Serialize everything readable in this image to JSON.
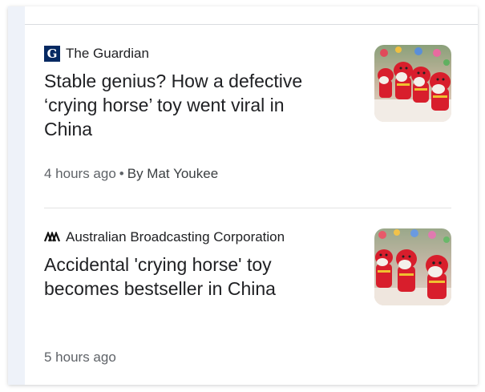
{
  "articles": [
    {
      "source": "The Guardian",
      "source_logo": "guardian-logo-icon",
      "headline": "Stable genius? How a defective ‘crying horse’ toy went viral in China",
      "time": "4 hours ago",
      "separator": "•",
      "byline": "By Mat Youkee",
      "thumbnail": "crying-horse-toys-photo"
    },
    {
      "source": "Australian Broadcasting Corporation",
      "source_logo": "abc-logo-icon",
      "headline": "Accidental 'crying horse' toy becomes bestseller in China",
      "time": "5 hours ago",
      "thumbnail": "crying-horse-toys-photo"
    }
  ],
  "colors": {
    "text_primary": "#202124",
    "text_secondary": "#5f6368",
    "divider": "#dadce0",
    "guardian_blue": "#052962",
    "toy_red": "#d81e2c"
  }
}
